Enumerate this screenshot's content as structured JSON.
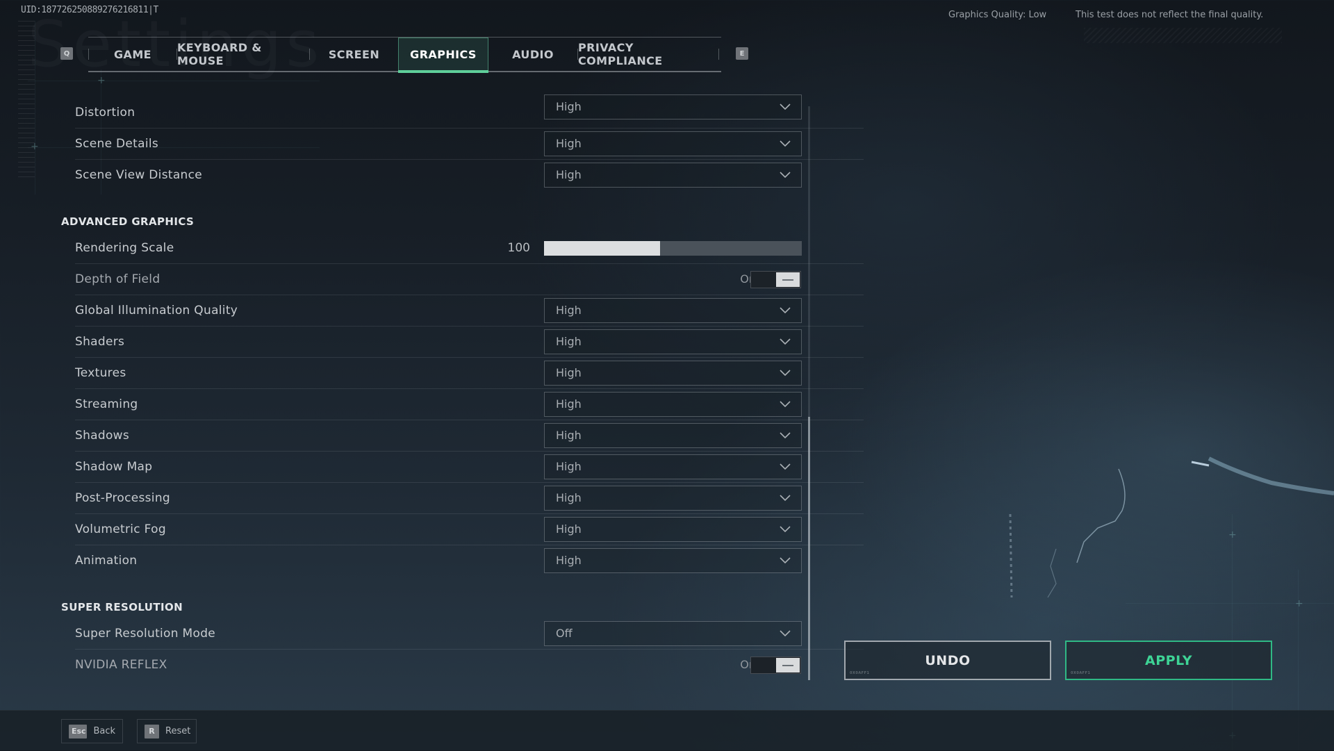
{
  "uid": "UID:18772625088927621681​1|T",
  "background_title": "Settings",
  "header": {
    "graphics_quality": "Graphics Quality: Low",
    "notice": "This test does not reflect the final quality."
  },
  "tabs": {
    "prev_key": "Q",
    "next_key": "E",
    "items": [
      {
        "label": "GAME",
        "active": false
      },
      {
        "label": "KEYBOARD & MOUSE",
        "active": false
      },
      {
        "label": "SCREEN",
        "active": false
      },
      {
        "label": "GRAPHICS",
        "active": true
      },
      {
        "label": "AUDIO",
        "active": false
      },
      {
        "label": "PRIVACY COMPLIANCE",
        "active": false
      }
    ]
  },
  "settings": {
    "basic": [
      {
        "label": "Distortion",
        "value": "High"
      },
      {
        "label": "Scene Details",
        "value": "High"
      },
      {
        "label": "Scene View Distance",
        "value": "High"
      }
    ],
    "advanced_title": "ADVANCED GRAPHICS",
    "rendering_scale": {
      "label": "Rendering Scale",
      "value": "100",
      "fill_fraction": 0.45
    },
    "depth_of_field": {
      "label": "Depth of Field",
      "state": "On"
    },
    "advanced": [
      {
        "label": "Global Illumination Quality",
        "value": "High"
      },
      {
        "label": "Shaders",
        "value": "High"
      },
      {
        "label": "Textures",
        "value": "High"
      },
      {
        "label": "Streaming",
        "value": "High"
      },
      {
        "label": "Shadows",
        "value": "High"
      },
      {
        "label": "Shadow Map",
        "value": "High"
      },
      {
        "label": "Post-Processing",
        "value": "High"
      },
      {
        "label": "Volumetric Fog",
        "value": "High"
      },
      {
        "label": "Animation",
        "value": "High"
      }
    ],
    "super_title": "SUPER RESOLUTION",
    "super_resolution_mode": {
      "label": "Super Resolution Mode",
      "value": "Off"
    },
    "nvidia_reflex": {
      "label": "NVIDIA REFLEX",
      "state": "On"
    }
  },
  "actions": {
    "undo": "UNDO",
    "apply": "APPLY",
    "button_tag": "0X0AFF1"
  },
  "footer": {
    "back_key": "Esc",
    "back_label": "Back",
    "reset_key": "R",
    "reset_label": "Reset"
  },
  "colors": {
    "accent": "#5fcf9a",
    "apply_text": "#3ed496",
    "apply_border": "#2fb985"
  }
}
